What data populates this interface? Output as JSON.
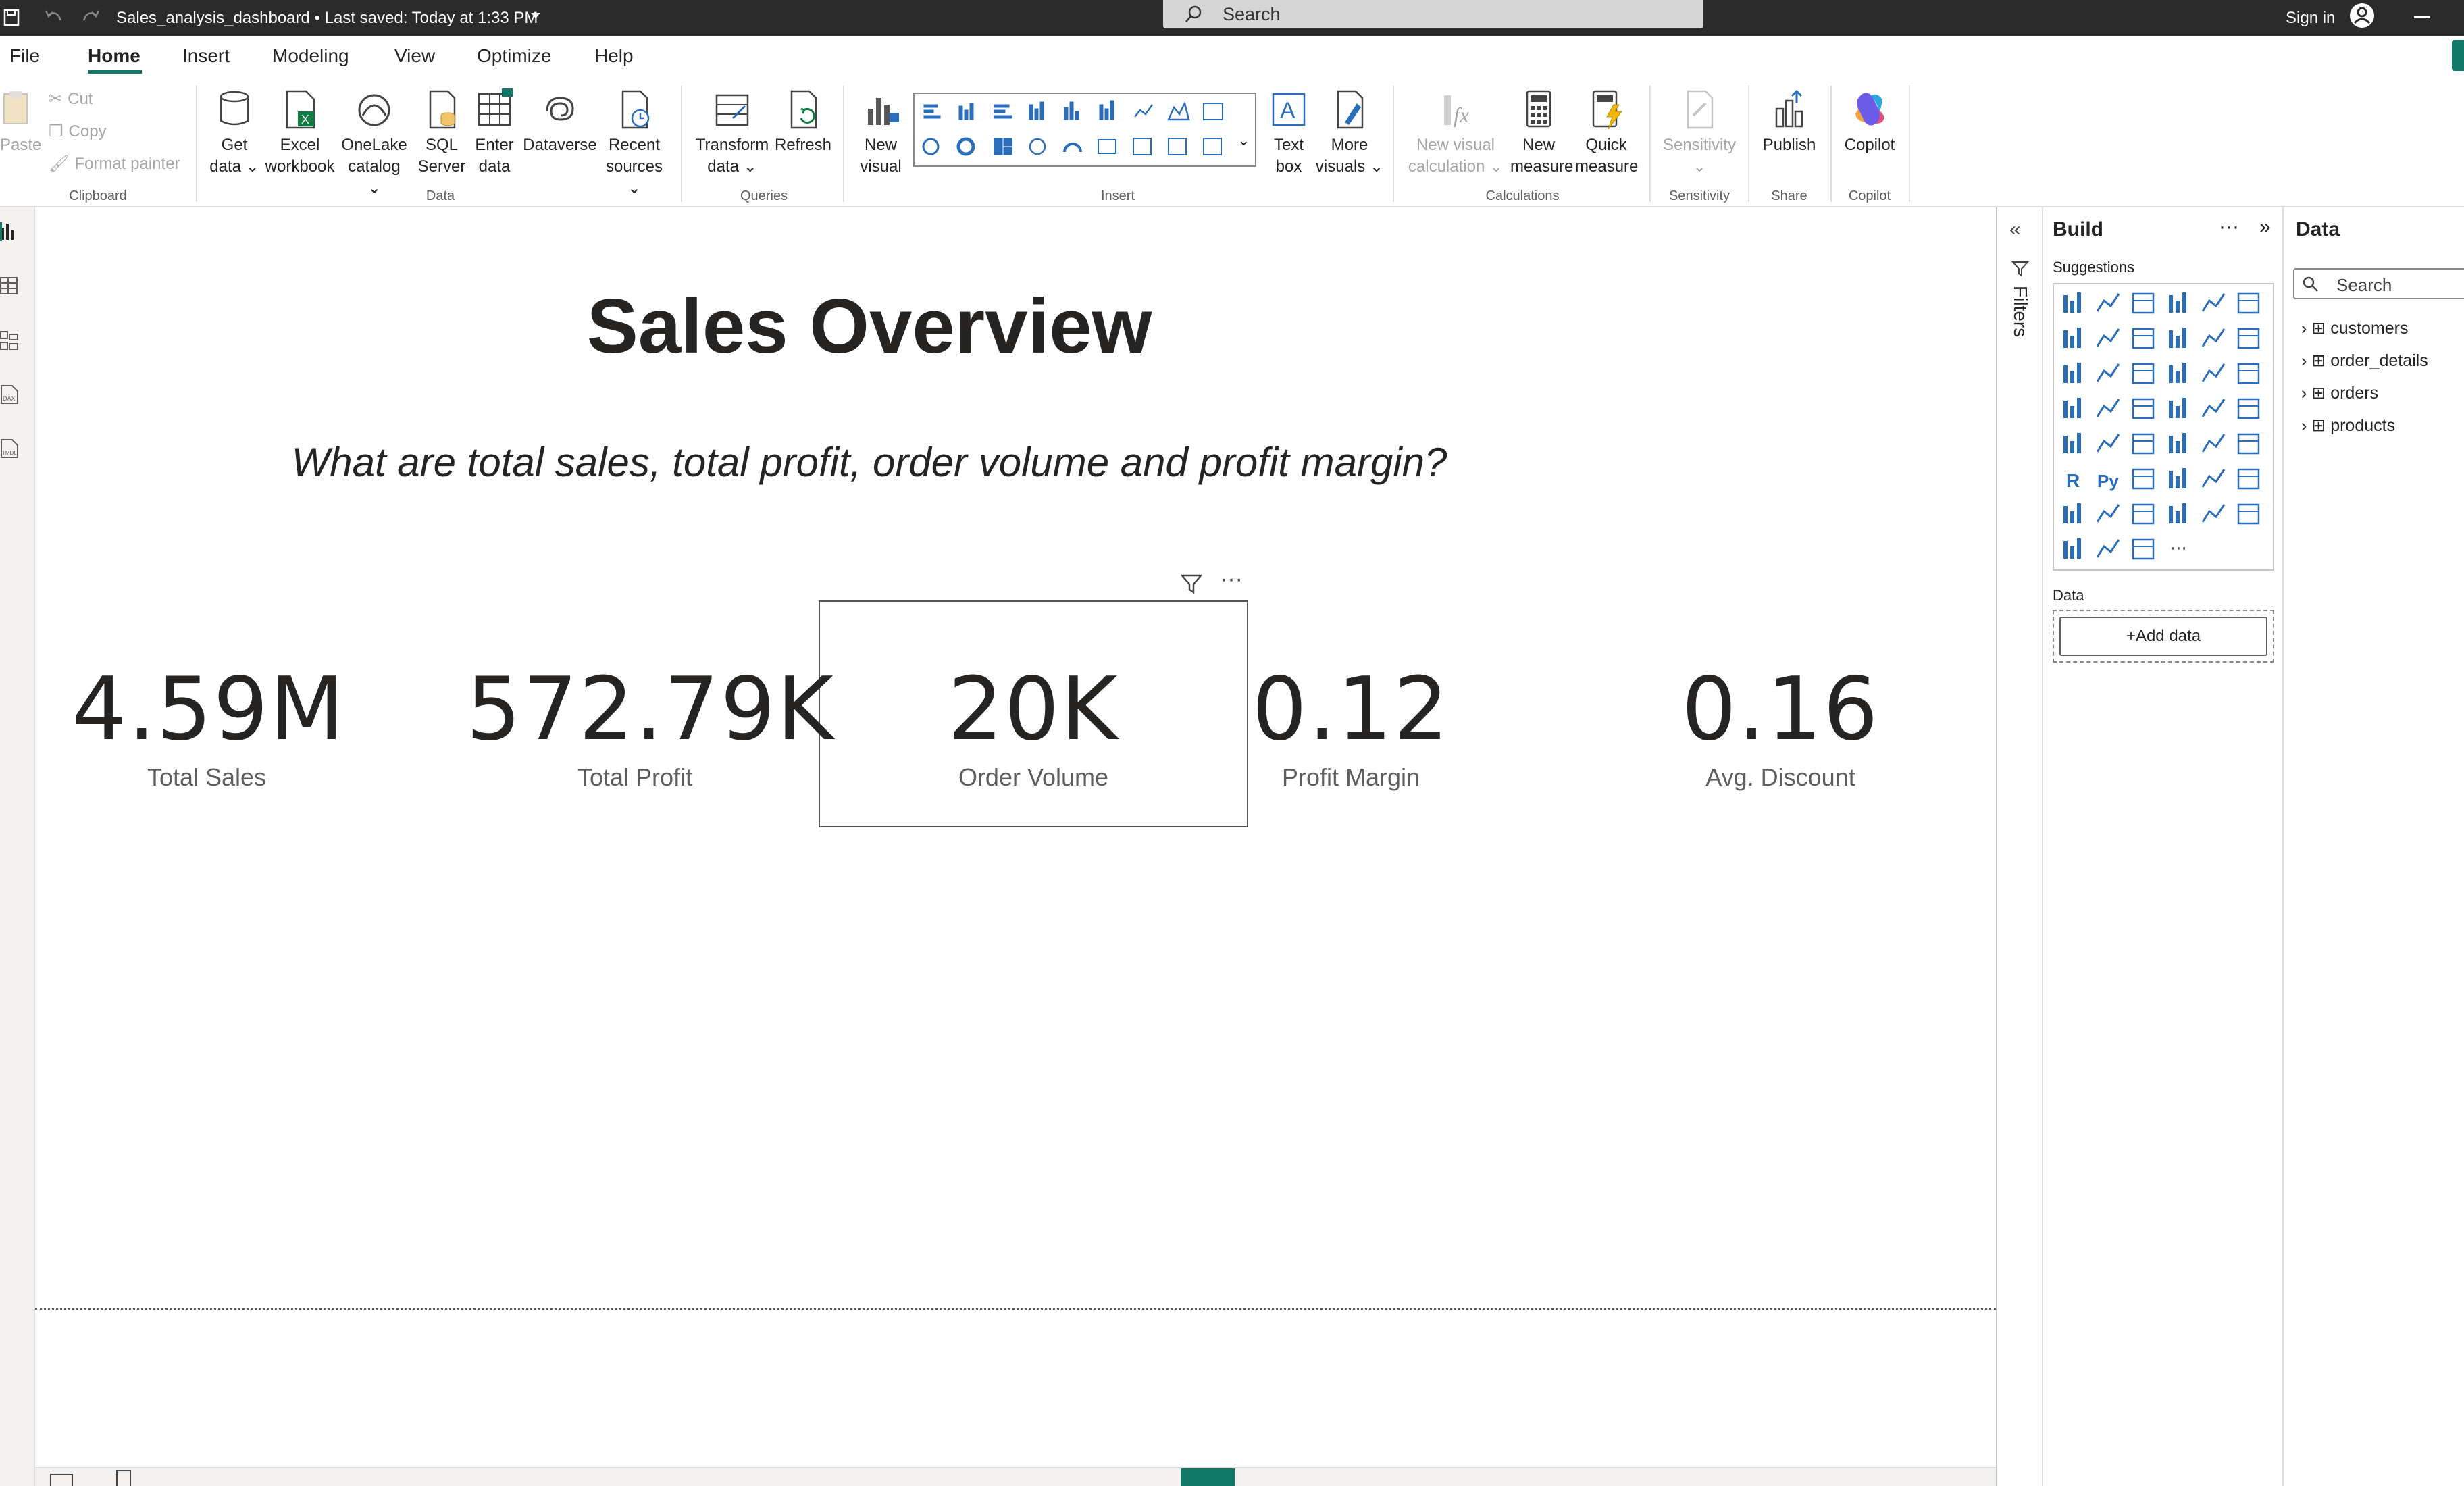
{
  "app": {
    "file_title": "Sales_analysis_dashboard",
    "saved_status": "Last saved: Today at 1:33 PM",
    "search_placeholder": "Search",
    "sign_in": "Sign in"
  },
  "menu_tabs": [
    "File",
    "Home",
    "Insert",
    "Modeling",
    "View",
    "Optimize",
    "Help"
  ],
  "active_tab": "Home",
  "ribbon": {
    "clipboard": {
      "paste": "Paste",
      "cut": "Cut",
      "copy": "Copy",
      "format_painter": "Format painter",
      "group": "Clipboard"
    },
    "data": {
      "get_data": "Get",
      "get_data2": "data",
      "excel": "Excel",
      "excel2": "workbook",
      "onelake": "OneLake",
      "onelake2": "catalog",
      "sql": "SQL",
      "sql2": "Server",
      "enter": "Enter",
      "enter2": "data",
      "dataverse": "Dataverse",
      "recent": "Recent",
      "recent2": "sources",
      "group": "Data"
    },
    "queries": {
      "transform": "Transform",
      "transform2": "data",
      "refresh": "Refresh",
      "group": "Queries"
    },
    "insert": {
      "new_visual": "New",
      "new_visual2": "visual",
      "text_box": "Text",
      "text_box2": "box",
      "more_visuals": "More",
      "more_visuals2": "visuals",
      "group": "Insert"
    },
    "calculations": {
      "new_visual_calc": "New visual",
      "new_visual_calc2": "calculation",
      "new_measure": "New",
      "new_measure2": "measure",
      "quick_measure": "Quick",
      "quick_measure2": "measure",
      "group": "Calculations"
    },
    "sensitivity": {
      "label": "Sensitivity",
      "group": "Sensitivity"
    },
    "share": {
      "publish": "Publish",
      "group": "Share"
    },
    "copilot": {
      "label": "Copilot",
      "group": "Copilot"
    }
  },
  "report": {
    "title": "Sales Overview",
    "subtitle": "What are total sales, total profit, order volume and profit margin?",
    "cards": [
      {
        "value": "4.59M",
        "label": "Total Sales"
      },
      {
        "value": "572.79K",
        "label": "Total Profit"
      },
      {
        "value": "20K",
        "label": "Order Volume"
      },
      {
        "value": "0.12",
        "label": "Profit Margin"
      },
      {
        "value": "0.16",
        "label": "Avg. Discount"
      }
    ],
    "selected_card_menu": "···"
  },
  "filters_pane": {
    "label": "Filters"
  },
  "build_pane": {
    "title": "Build",
    "suggestions": "Suggestions",
    "data_label": "Data",
    "add_data": "+Add data",
    "more": "···"
  },
  "data_pane": {
    "title": "Data",
    "search_placeholder": "Search",
    "tables": [
      "customers",
      "order_details",
      "orders",
      "products"
    ]
  },
  "colors": {
    "accent": "#117865",
    "titlebar": "#2b2b2b",
    "viz_blue": "#2a6ebb"
  }
}
